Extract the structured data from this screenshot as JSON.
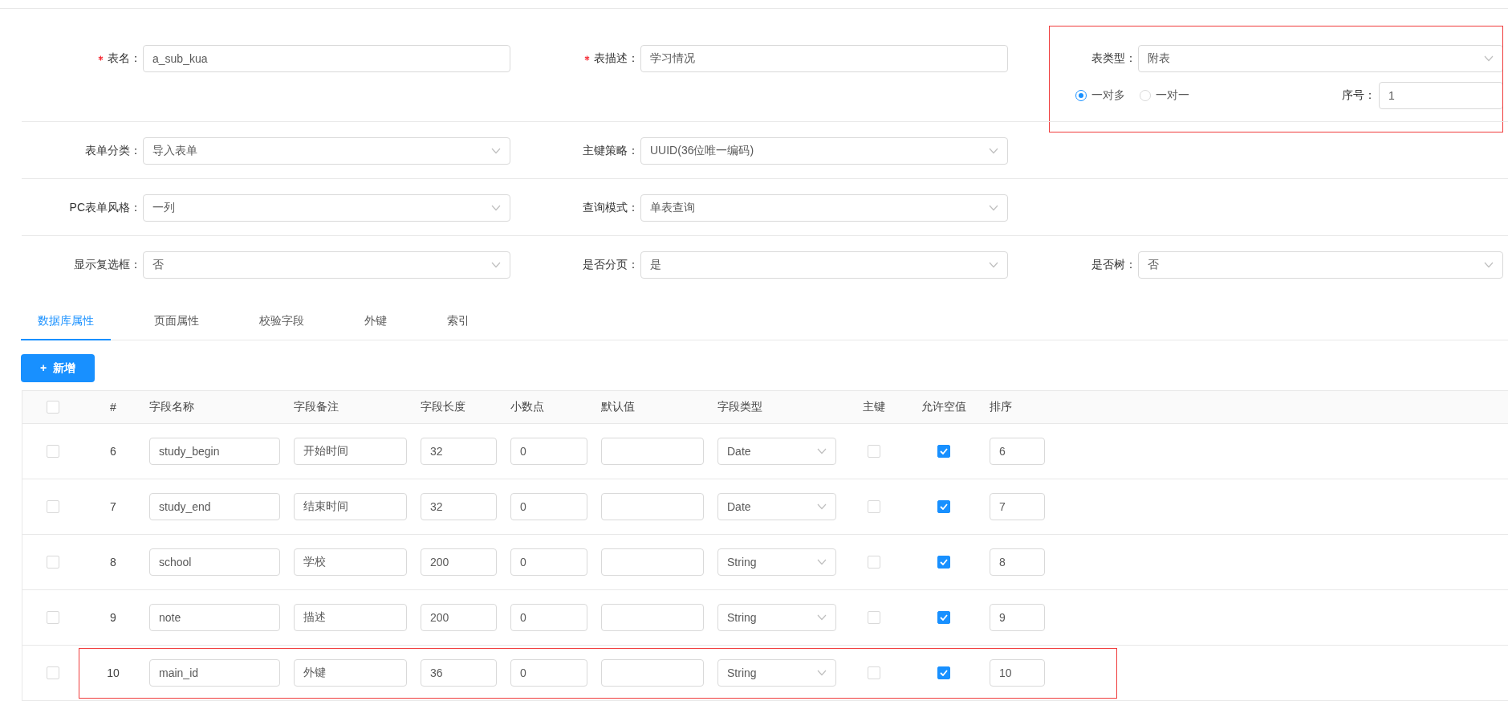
{
  "form_rows": [
    {
      "fields": [
        {
          "kind": "input",
          "label": "表名：",
          "required": true,
          "value": "a_sub_kua"
        },
        {
          "kind": "input",
          "label": "表描述：",
          "required": true,
          "value": "学习情况"
        },
        {
          "kind": "table_type",
          "label": "表类型：",
          "required": false,
          "value": "附表",
          "highlighted": true,
          "relations": [
            {
              "label": "一对多",
              "selected": true
            },
            {
              "label": "一对一",
              "selected": false
            }
          ],
          "order": {
            "label": "序号：",
            "value": "1"
          }
        }
      ]
    },
    {
      "fields": [
        {
          "kind": "select",
          "label": "表单分类：",
          "required": false,
          "value": "导入表单"
        },
        {
          "kind": "select",
          "label": "主键策略：",
          "required": false,
          "value": "UUID(36位唯一编码)"
        }
      ]
    },
    {
      "fields": [
        {
          "kind": "select",
          "label": "PC表单风格：",
          "required": false,
          "value": "一列"
        },
        {
          "kind": "select",
          "label": "查询模式：",
          "required": false,
          "value": "单表查询"
        }
      ]
    },
    {
      "fields": [
        {
          "kind": "select",
          "label": "显示复选框：",
          "required": false,
          "value": "否"
        },
        {
          "kind": "select",
          "label": "是否分页：",
          "required": false,
          "value": "是"
        },
        {
          "kind": "select",
          "label": "是否树：",
          "required": false,
          "value": "否"
        }
      ]
    }
  ],
  "tabs": [
    {
      "label": "数据库属性",
      "selected": true
    },
    {
      "label": "页面属性",
      "selected": false
    },
    {
      "label": "校验字段",
      "selected": false
    },
    {
      "label": "外键",
      "selected": false
    },
    {
      "label": "索引",
      "selected": false
    }
  ],
  "add_button": {
    "icon": "+",
    "label": "新增"
  },
  "table": {
    "header_checked": false,
    "columns": [
      "#",
      "字段名称",
      "字段备注",
      "字段长度",
      "小数点",
      "默认值",
      "字段类型",
      "主键",
      "允许空值",
      "排序"
    ],
    "rows": [
      {
        "checked": false,
        "index": "6",
        "name": "study_begin",
        "remark": "开始时间",
        "length": "32",
        "decimals": "0",
        "default": "",
        "type": "Date",
        "primary_key": false,
        "nullable": true,
        "sort": "6",
        "highlighted": false
      },
      {
        "checked": false,
        "index": "7",
        "name": "study_end",
        "remark": "结束时间",
        "length": "32",
        "decimals": "0",
        "default": "",
        "type": "Date",
        "primary_key": false,
        "nullable": true,
        "sort": "7",
        "highlighted": false
      },
      {
        "checked": false,
        "index": "8",
        "name": "school",
        "remark": "学校",
        "length": "200",
        "decimals": "0",
        "default": "",
        "type": "String",
        "primary_key": false,
        "nullable": true,
        "sort": "8",
        "highlighted": false
      },
      {
        "checked": false,
        "index": "9",
        "name": "note",
        "remark": "描述",
        "length": "200",
        "decimals": "0",
        "default": "",
        "type": "String",
        "primary_key": false,
        "nullable": true,
        "sort": "9",
        "highlighted": false
      },
      {
        "checked": false,
        "index": "10",
        "name": "main_id",
        "remark": "外键",
        "length": "36",
        "decimals": "0",
        "default": "",
        "type": "String",
        "primary_key": false,
        "nullable": true,
        "sort": "10",
        "highlighted": true
      }
    ]
  }
}
